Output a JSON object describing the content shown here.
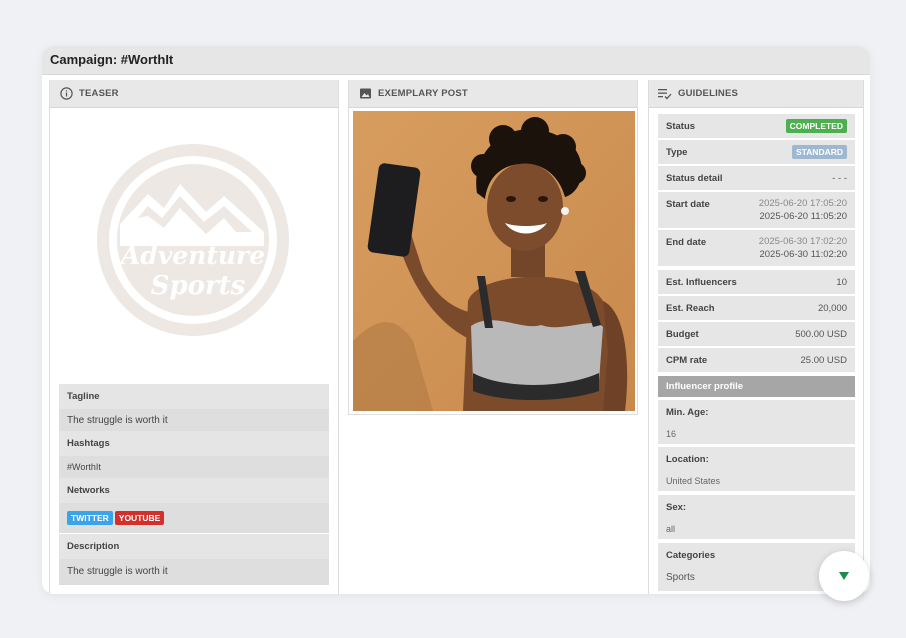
{
  "window": {
    "title": "Campaign: #WorthIt"
  },
  "teaser": {
    "header": "TEASER",
    "logo_text_1": "Adventure",
    "logo_text_2": "Sports",
    "tagline_label": "Tagline",
    "tagline_value": "The struggle is worth it",
    "hashtags_label": "Hashtags",
    "hashtags_value": "#WorthIt",
    "networks_label": "Networks",
    "networks": [
      {
        "label": "TWITTER",
        "color": "#3ba3e8"
      },
      {
        "label": "YOUTUBE",
        "color": "#d2302b"
      }
    ],
    "description_label": "Description",
    "description_value": "The struggle is worth it"
  },
  "post": {
    "header": "EXEMPLARY POST"
  },
  "guidelines": {
    "header": "GUIDELINES",
    "status_label": "Status",
    "status_value": "COMPLETED",
    "status_color": "#4caf50",
    "type_label": "Type",
    "type_value": "STANDARD",
    "type_color": "#9fb8d2",
    "status_detail_label": "Status detail",
    "status_detail_value": "- - -",
    "start_label": "Start date",
    "start_value_1": "2025-06-20 17:05:20",
    "start_value_2": "2025-06-20 11:05:20",
    "end_label": "End date",
    "end_value_1": "2025-06-30 17:02:20",
    "end_value_2": "2025-06-30 11:02:20",
    "influencers_label": "Est. Influencers",
    "influencers_value": "10",
    "reach_label": "Est. Reach",
    "reach_value": "20,000",
    "budget_label": "Budget",
    "budget_value": "500.00 USD",
    "cpm_label": "CPM rate",
    "cpm_value": "25.00 USD",
    "profile_section": "Influencer profile",
    "age_label": "Min. Age:",
    "age_value": "16",
    "location_label": "Location:",
    "location_value": "United States",
    "sex_label": "Sex:",
    "sex_value": "all",
    "categories_label": "Categories",
    "categories_value": "Sports"
  }
}
